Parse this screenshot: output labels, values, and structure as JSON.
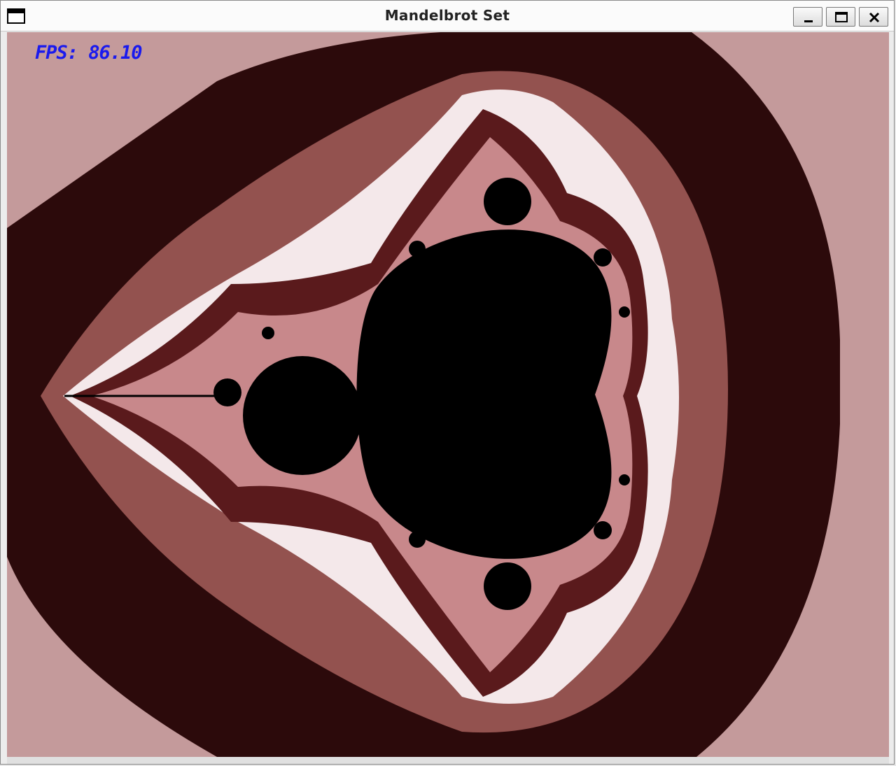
{
  "window": {
    "title": "Mandelbrot Set",
    "controls": {
      "minimize_icon": "minimize-icon",
      "maximize_icon": "maximize-icon",
      "close_icon": "close-icon"
    }
  },
  "overlay": {
    "fps_text": "FPS: 86.10"
  },
  "colors": {
    "fps_text": "#1a1aee",
    "band_outer": "#c49a9b",
    "band_dark": "#2c0a0b",
    "band_mid": "#93524f",
    "band_light": "#f4e8ea",
    "band_detail": "#5a1a1c",
    "set_interior": "#000000"
  }
}
